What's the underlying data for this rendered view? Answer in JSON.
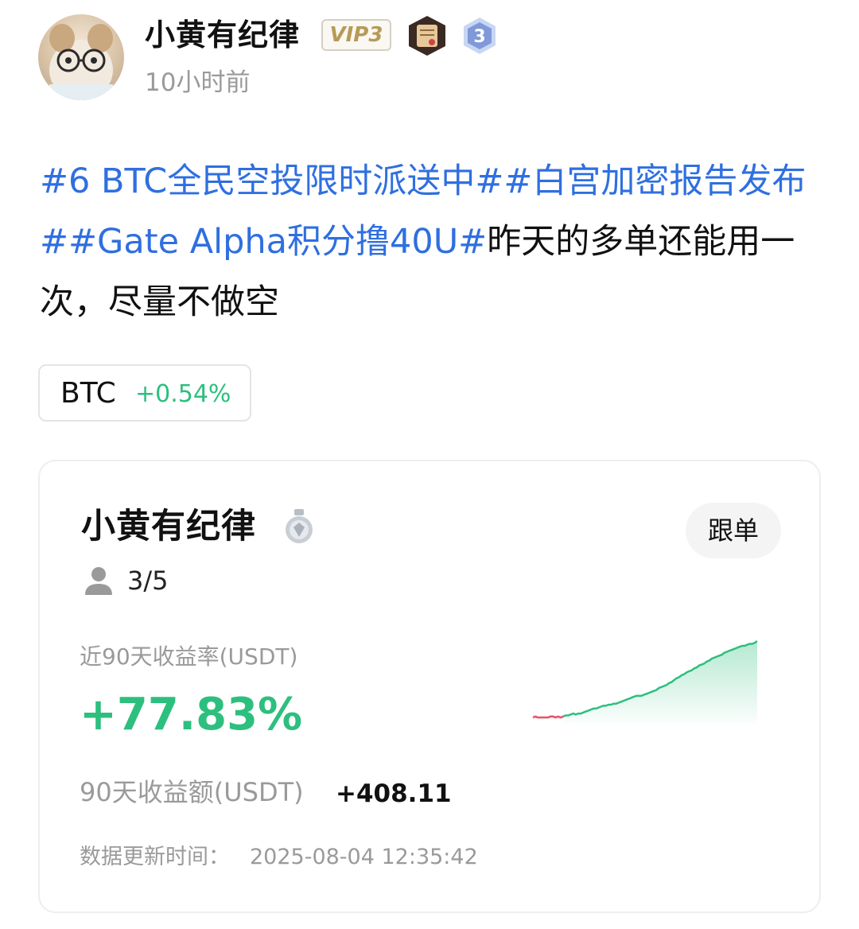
{
  "post": {
    "author": "小黄有纪律",
    "vip_label": "VIP3",
    "level": "3",
    "time": "10小时前",
    "hashtags": [
      "#6 BTC全民空投限时派送中#",
      "#白宫加密报告发布#",
      "#Gate Alpha积分撸40U#"
    ],
    "body_text": "昨天的多单还能用一次，尽量不做空",
    "icons": {
      "avatar": "avatar-image",
      "cert": "certificate-badge-icon",
      "level": "level-hexagon-icon"
    }
  },
  "coin_chip": {
    "symbol": "BTC",
    "change": "+0.54%"
  },
  "copy_trade_card": {
    "trader_name": "小黄有纪律",
    "medal_icon": "silver-medal-icon",
    "follow_button": "跟单",
    "follower_icon": "user-icon",
    "followers": "3/5",
    "roi_label": "近90天收益率(USDT)",
    "roi_value": "+77.83%",
    "pnl_label": "90天收益额(USDT)",
    "pnl_value": "+408.11",
    "updated_label": "数据更新时间：",
    "updated_value": "2025-08-04 12:35:42"
  },
  "colors": {
    "hashtag": "#2f6fe0",
    "positive": "#2dbf7e",
    "negative": "#e0566b",
    "muted": "#9a9a9a"
  },
  "chart_data": {
    "type": "line",
    "title": "",
    "xlabel": "",
    "ylabel": "",
    "grid": false,
    "legend": "none",
    "series": [
      {
        "values": [
          0,
          1,
          0,
          0,
          0,
          0,
          0,
          1,
          1,
          0,
          1,
          0,
          1,
          2,
          2,
          3,
          4,
          3,
          4,
          4,
          5,
          6,
          7,
          8,
          9,
          9,
          10,
          11,
          12,
          12,
          13,
          13,
          14,
          14,
          15,
          16,
          17,
          18,
          19,
          20,
          21,
          22,
          22,
          22,
          23,
          24,
          25,
          26,
          27,
          28,
          30,
          31,
          32,
          33,
          35,
          36,
          38,
          40,
          41,
          43,
          44,
          46,
          47,
          48,
          50,
          51,
          53,
          54,
          55,
          57,
          58,
          60,
          61,
          62,
          63,
          64,
          66,
          67,
          68,
          69,
          70,
          71,
          72,
          73,
          73,
          74,
          75,
          75,
          76,
          77.83
        ]
      }
    ]
  }
}
